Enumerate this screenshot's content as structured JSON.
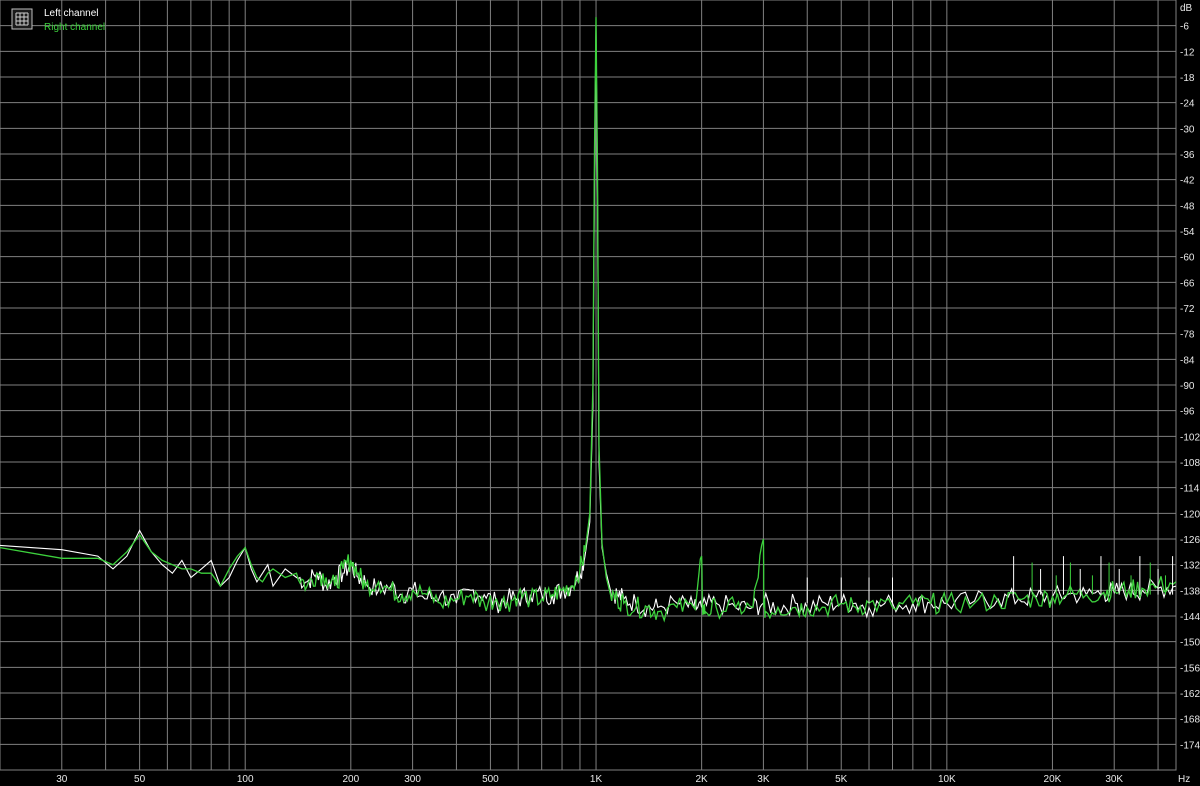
{
  "legend": {
    "items": [
      {
        "label": "Left channel",
        "color": "#ffffff"
      },
      {
        "label": "Right channel",
        "color": "#3dd13d"
      }
    ],
    "icon": "grid-icon"
  },
  "colors": {
    "background": "#000000",
    "grid": "#808080",
    "text": "#e8e8e8",
    "left": "#ffffff",
    "right": "#3dd13d"
  },
  "chart_data": {
    "type": "line",
    "x_scale": "log",
    "xlim": [
      20,
      45000
    ],
    "ylim": [
      -180,
      0
    ],
    "xunit": "Hz",
    "yunit": "dB",
    "grid": true,
    "legend_position": "top-left",
    "x_ticks": [
      {
        "value": 30,
        "label": "30"
      },
      {
        "value": 50,
        "label": "50"
      },
      {
        "value": 100,
        "label": "100"
      },
      {
        "value": 200,
        "label": "200"
      },
      {
        "value": 300,
        "label": "300"
      },
      {
        "value": 500,
        "label": "500"
      },
      {
        "value": 1000,
        "label": "1K"
      },
      {
        "value": 2000,
        "label": "2K"
      },
      {
        "value": 3000,
        "label": "3K"
      },
      {
        "value": 5000,
        "label": "5K"
      },
      {
        "value": 10000,
        "label": "10K"
      },
      {
        "value": 20000,
        "label": "20K"
      },
      {
        "value": 30000,
        "label": "30K"
      }
    ],
    "y_ticks": [
      "-6",
      "-12",
      "-18",
      "-24",
      "-30",
      "-36",
      "-42",
      "-48",
      "-54",
      "-60",
      "-66",
      "-72",
      "-78",
      "-84",
      "-90",
      "-96",
      "-102",
      "-108",
      "-114",
      "-120",
      "-126",
      "-132",
      "-138",
      "-144",
      "-150",
      "-156",
      "-162",
      "-168",
      "-174"
    ],
    "series": [
      {
        "name": "Left channel",
        "x": [
          20,
          30,
          38,
          42,
          46,
          50,
          54,
          58,
          62,
          66,
          70,
          75,
          80,
          85,
          90,
          95,
          100,
          104,
          108,
          112,
          116,
          120,
          130,
          140,
          150,
          160,
          170,
          180,
          190,
          200,
          210,
          220,
          240,
          260,
          280,
          300,
          330,
          360,
          400,
          440,
          480,
          520,
          560,
          600,
          650,
          700,
          750,
          800,
          850,
          900,
          930,
          960,
          980,
          990,
          1000,
          1010,
          1020,
          1040,
          1070,
          1100,
          1150,
          1200,
          1300,
          1400,
          1500,
          1700,
          1900,
          2000,
          2200,
          2500,
          2800,
          3000,
          3300,
          3700,
          4000,
          4500,
          5000,
          5500,
          6000,
          7000,
          8000,
          9000,
          10000,
          12000,
          14000,
          16000,
          18000,
          20000,
          22000,
          25000,
          28000,
          30000,
          33000,
          36000,
          40000,
          45000
        ],
        "y": [
          -127.5,
          -128.5,
          -130,
          -133,
          -130,
          -124,
          -129,
          -132,
          -134,
          -131,
          -135,
          -133,
          -131,
          -137,
          -135,
          -131,
          -128,
          -133,
          -136,
          -134,
          -132,
          -137,
          -133,
          -135,
          -136,
          -134,
          -137,
          -135,
          -134,
          -132,
          -135,
          -136,
          -138,
          -137,
          -139,
          -138,
          -140,
          -139,
          -141,
          -138,
          -139,
          -141,
          -140,
          -140,
          -139,
          -139,
          -139,
          -138,
          -137,
          -134,
          -130,
          -122,
          -95,
          -40,
          -6,
          -45,
          -108,
          -128,
          -134,
          -138,
          -139,
          -140,
          -141,
          -142,
          -142,
          -141,
          -142,
          -142,
          -141,
          -142,
          -142,
          -141,
          -142,
          -141,
          -142,
          -141,
          -141,
          -141,
          -142,
          -141,
          -141,
          -141,
          -141,
          -140.5,
          -140,
          -140,
          -139.5,
          -139.5,
          -139,
          -139,
          -138.5,
          -138.5,
          -138,
          -138,
          -137.5,
          -137
        ],
        "color": "#ffffff"
      },
      {
        "name": "Right channel",
        "x": [
          20,
          30,
          38,
          42,
          46,
          50,
          54,
          58,
          62,
          66,
          70,
          75,
          80,
          85,
          90,
          95,
          100,
          104,
          108,
          112,
          116,
          120,
          130,
          140,
          150,
          160,
          170,
          180,
          190,
          200,
          210,
          220,
          240,
          260,
          280,
          300,
          330,
          360,
          400,
          440,
          480,
          520,
          560,
          600,
          650,
          700,
          750,
          800,
          850,
          900,
          930,
          960,
          980,
          990,
          1000,
          1010,
          1020,
          1040,
          1070,
          1100,
          1150,
          1200,
          1300,
          1400,
          1500,
          1700,
          1900,
          2000,
          2010,
          2050,
          2200,
          2500,
          2800,
          3000,
          3010,
          3050,
          3300,
          3700,
          4000,
          4500,
          5000,
          5500,
          6000,
          7000,
          8000,
          9000,
          10000,
          12000,
          14000,
          16000,
          18000,
          20000,
          22000,
          25000,
          28000,
          30000,
          33000,
          36000,
          40000,
          45000
        ],
        "y": [
          -128,
          -130.5,
          -130.5,
          -132,
          -129,
          -125,
          -129,
          -131,
          -132,
          -133,
          -133,
          -134,
          -134,
          -137,
          -133,
          -130,
          -128,
          -132,
          -135,
          -136,
          -134,
          -133,
          -135,
          -134,
          -137,
          -134,
          -135,
          -137,
          -133,
          -131,
          -134,
          -137,
          -136,
          -138,
          -139,
          -138,
          -139,
          -141,
          -140,
          -139,
          -141,
          -140,
          -141,
          -139,
          -140,
          -140,
          -139,
          -138,
          -137,
          -133,
          -129,
          -120,
          -90,
          -35,
          -4,
          -40,
          -104,
          -127,
          -135,
          -139,
          -140,
          -141,
          -142,
          -142,
          -143,
          -142,
          -142,
          -130,
          -142,
          -143,
          -142,
          -142,
          -142,
          -126,
          -142,
          -143,
          -142,
          -142,
          -142,
          -142,
          -141,
          -142,
          -141,
          -142,
          -141,
          -141,
          -141,
          -141,
          -140.5,
          -140,
          -140,
          -139.5,
          -139,
          -139,
          -138.5,
          -138,
          -138,
          -137.5,
          -137,
          -136
        ],
        "color": "#3dd13d"
      }
    ]
  }
}
